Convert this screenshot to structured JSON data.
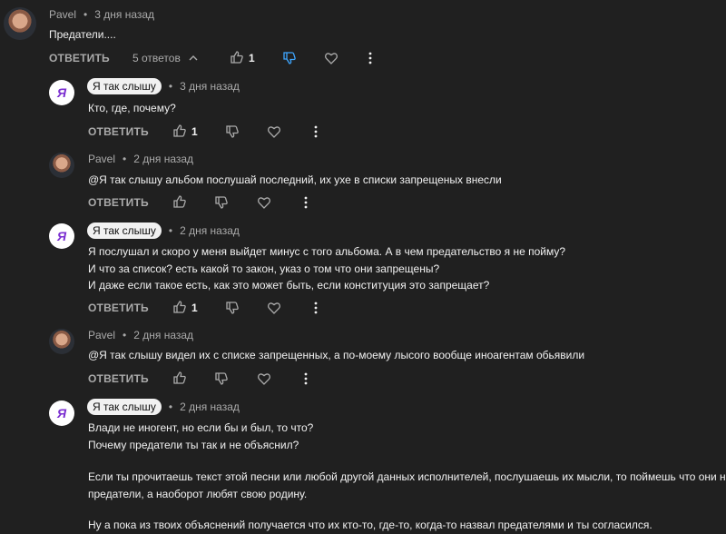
{
  "top_comment": {
    "author": "Pavel",
    "time": "3 дня назад",
    "text": "Предатели....",
    "reply_label": "ОТВЕТИТЬ",
    "replies_count": "5 ответов",
    "likes": "1"
  },
  "replies": [
    {
      "author": "Я так слышу",
      "time": "3 дня назад",
      "lines": [
        "Кто, где, почему?"
      ],
      "reply_label": "ОТВЕТИТЬ",
      "likes": "1"
    },
    {
      "author": "Pavel",
      "time": "2 дня назад",
      "lines": [
        " @Я так слышу  альбом послушай последний, их ухе в списки запрещеных внесли"
      ],
      "reply_label": "ОТВЕТИТЬ",
      "likes": ""
    },
    {
      "author": "Я так слышу",
      "time": "2 дня назад",
      "lines": [
        "Я послушал и скоро у меня выйдет минус с того альбома. А в чем предательство я не пойму?",
        "И что за список? есть какой то закон, указ о том что они запрещены?",
        "И даже если такое есть, как это может быть, если конституция это запрещает?"
      ],
      "reply_label": "ОТВЕТИТЬ",
      "likes": "1"
    },
    {
      "author": "Pavel",
      "time": "2 дня назад",
      "lines": [
        " @Я так слышу  видел их с списке запрещенных, а по-моему лысого вообще иноагентам обьявили"
      ],
      "reply_label": "ОТВЕТИТЬ",
      "likes": ""
    },
    {
      "author": "Я так слышу",
      "time": "2 дня назад",
      "lines": [
        "Влади не иногент, но если бы и был, то что?",
        "Почему предатели ты так и не объяснил?",
        "",
        "Если ты прочитаешь текст этой песни или любой другой данных исполнителей, послушаешь их мысли, то поймешь что они не",
        "предатели, а наоборот любят свою родину.",
        "",
        "Ну а пока из твоих объяснений получается что их кто-то, где-то, когда-то назвал предателями и ты согласился."
      ]
    }
  ],
  "separator": "•",
  "icons": {
    "like": "thumbs-up-icon",
    "dislike": "thumbs-down-icon",
    "heart": "heart-icon",
    "more": "more-vert-icon",
    "chevron": "chevron-up-icon",
    "avatar_letter": "Я"
  },
  "colors": {
    "background": "#202020",
    "dislike_active": "#3ea6ff",
    "text": "#f1f1f1",
    "muted": "#aaaaaa"
  }
}
